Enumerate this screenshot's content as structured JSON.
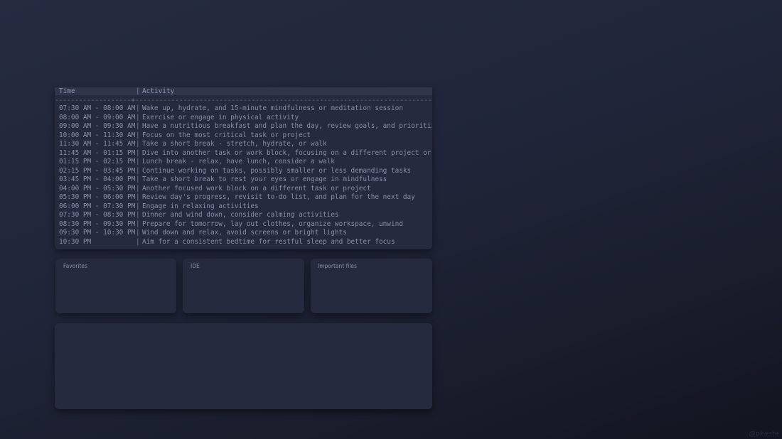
{
  "schedule": {
    "header": {
      "time": "Time",
      "activity": "Activity",
      "separator": "|"
    },
    "divider": "-------------------+----------------------------------------------------------------------------------",
    "separator": "|",
    "rows": [
      {
        "time": "07:30 AM - 08:00 AM",
        "activity": "Wake up, hydrate, and 15-minute mindfulness or meditation session"
      },
      {
        "time": "08:00 AM - 09:00 AM",
        "activity": "Exercise or engage in physical activity"
      },
      {
        "time": "09:00 AM - 09:30 AM",
        "activity": "Have a nutritious breakfast and plan the day, review goals, and prioritize tasks"
      },
      {
        "time": "10:00 AM - 11:30 AM",
        "activity": "Focus on the most critical task or project"
      },
      {
        "time": "11:30 AM - 11:45 AM",
        "activity": "Take a short break - stretch, hydrate, or walk"
      },
      {
        "time": "11:45 AM - 01:15 PM",
        "activity": "Dive into another task or work block, focusing on a different project or aspect"
      },
      {
        "time": "01:15 PM - 02:15 PM",
        "activity": "Lunch break - relax, have lunch, consider a walk"
      },
      {
        "time": "02:15 PM - 03:45 PM",
        "activity": "Continue working on tasks, possibly smaller or less demanding tasks"
      },
      {
        "time": "03:45 PM - 04:00 PM",
        "activity": "Take a short break to rest your eyes or engage in mindfulness"
      },
      {
        "time": "04:00 PM - 05:30 PM",
        "activity": "Another focused work block on a different task or project"
      },
      {
        "time": "05:30 PM - 06:00 PM",
        "activity": "Review day's progress, revisit to-do list, and plan for the next day"
      },
      {
        "time": "06:00 PM - 07:30 PM",
        "activity": "Engage in relaxing activities"
      },
      {
        "time": "07:30 PM - 08:30 PM",
        "activity": "Dinner and wind down, consider calming activities"
      },
      {
        "time": "08:30 PM - 09:30 PM",
        "activity": "Prepare for tomorrow, lay out clothes, organize workspace, unwind"
      },
      {
        "time": "09:30 PM - 10:30 PM",
        "activity": "Wind down and relax, avoid screens or bright lights"
      },
      {
        "time": "10:30 PM",
        "activity": "Aim for a consistent bedtime for restful sleep and better focus"
      }
    ]
  },
  "widgets": {
    "favorites": {
      "title": "Favorites"
    },
    "ide": {
      "title": "IDE"
    },
    "important_files": {
      "title": "Important files"
    }
  },
  "watermark": "@pkasta",
  "colors": {
    "background": "#1f2436",
    "panel": "#252a3e",
    "header": "#2f354b",
    "text": "#8790a8"
  }
}
